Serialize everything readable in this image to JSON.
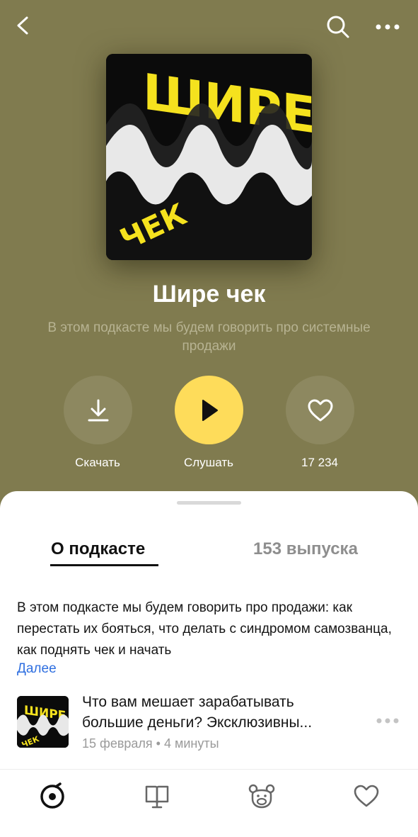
{
  "header": {
    "back_icon": "chevron-left-icon",
    "search_icon": "search-icon",
    "more_icon": "more-horizontal-icon"
  },
  "podcast": {
    "cover_text_top": "ШИРЕ",
    "cover_text_bottom": "ЧЕК",
    "title": "Шире чек",
    "subtitle": "В этом подкасте мы будем говорить про системные продажи"
  },
  "actions": {
    "download_label": "Скачать",
    "play_label": "Слушать",
    "likes_count": "17 234"
  },
  "tabs": {
    "about": "О подкасте",
    "episodes": "153 выпуска"
  },
  "about": {
    "description": "В этом подкасте мы будем говорить про продажи: как перестать их бояться, что делать с синдромом самозванца, как поднять чек и начать",
    "more_link": "Далее"
  },
  "episode": {
    "title": "Что вам мешает зарабатывать\nбольшие деньги? Эксклюзивны...",
    "meta": "15 февраля • 4 минуты"
  },
  "tabbar": {
    "items": [
      "player-icon",
      "book-icon",
      "bear-icon",
      "heart-icon"
    ]
  },
  "colors": {
    "accent": "#fedc5a",
    "background": "#807b4f",
    "link": "#2f6fe0"
  }
}
